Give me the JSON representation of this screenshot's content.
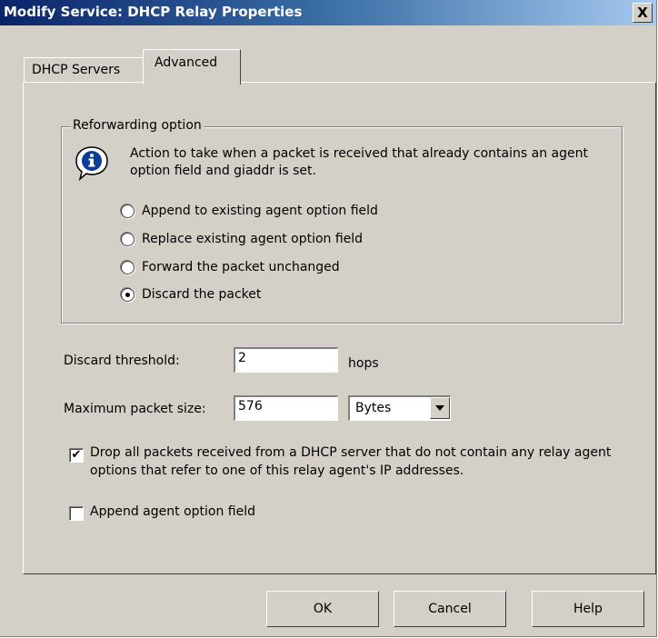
{
  "window": {
    "title": "Modify Service: DHCP Relay Properties",
    "close_glyph": "X"
  },
  "tabs": [
    {
      "label": "DHCP Servers"
    },
    {
      "label": "Advanced"
    }
  ],
  "reforwarding": {
    "group_label": "Reforwarding option",
    "icon": "info-icon",
    "description": "Action to take when a packet is received that already contains an agent option field and giaddr is set.",
    "options": [
      {
        "label": "Append to existing agent option field",
        "selected": false
      },
      {
        "label": "Replace existing agent option field",
        "selected": false
      },
      {
        "label": "Forward the packet unchanged",
        "selected": false
      },
      {
        "label": "Discard the packet",
        "selected": true
      }
    ]
  },
  "discard_threshold": {
    "label": "Discard threshold:",
    "value": "2",
    "unit": "hops"
  },
  "max_packet_size": {
    "label": "Maximum packet size:",
    "value": "576",
    "unit_selected": "Bytes"
  },
  "checkboxes": [
    {
      "label": "Drop all packets received from a DHCP server that do not contain any relay agent options that refer to one of this relay agent's IP addresses.",
      "checked": true
    },
    {
      "label": "Append agent option field",
      "checked": false
    }
  ],
  "buttons": {
    "ok": "OK",
    "cancel": "Cancel",
    "help": "Help"
  },
  "colors": {
    "face": "#d4d0c8",
    "title_start": "#0a246a",
    "title_end": "#a6caf0"
  }
}
